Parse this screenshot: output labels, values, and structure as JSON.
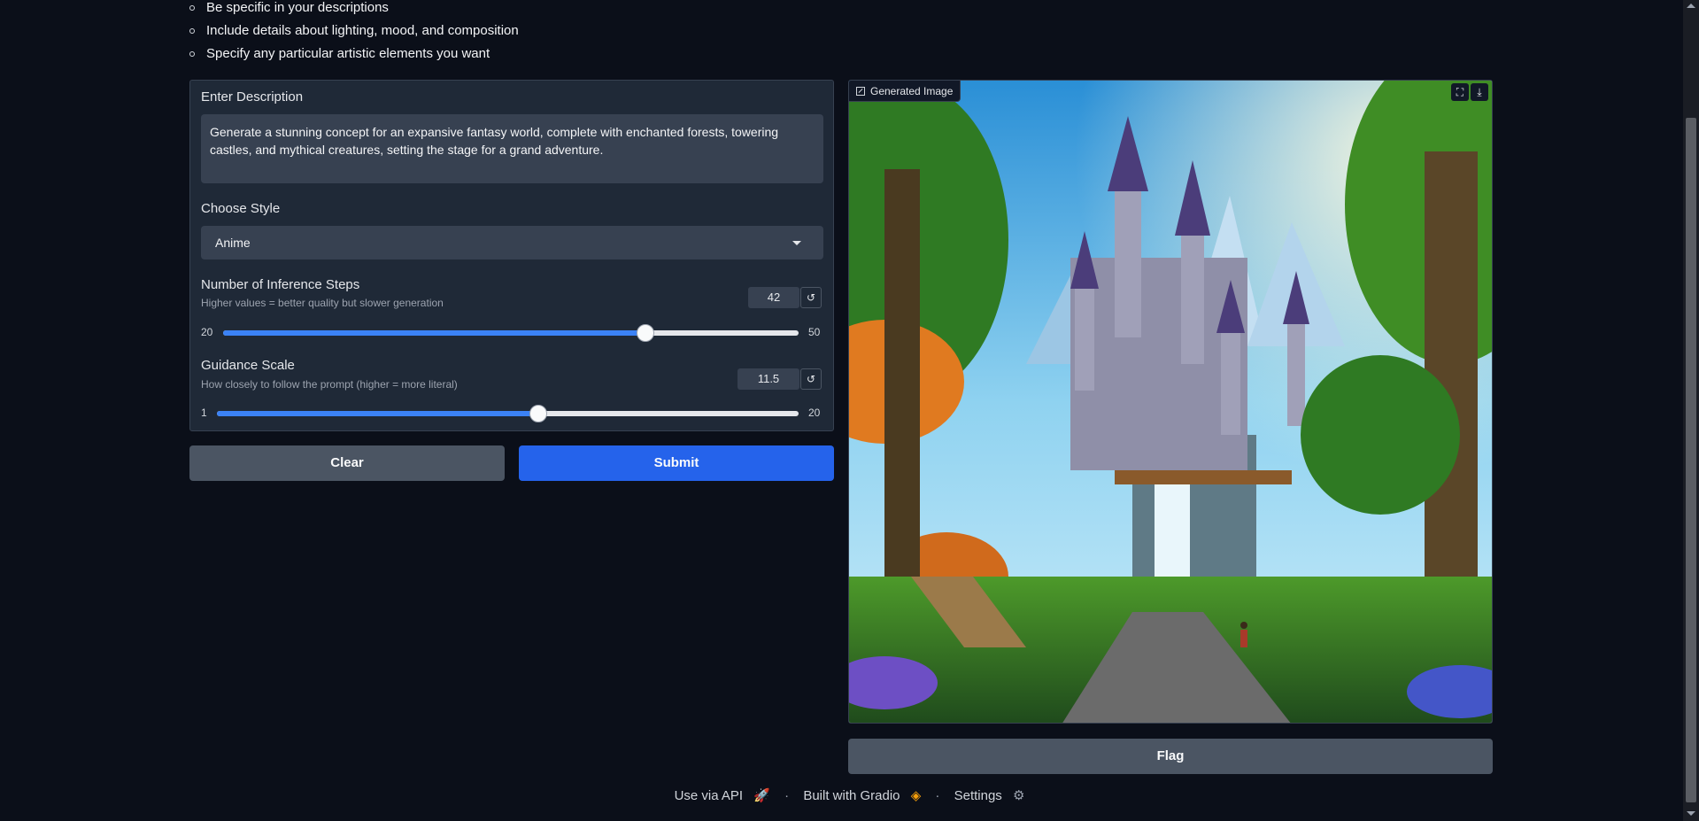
{
  "tips": [
    "Be specific in your descriptions",
    "Include details about lighting, mood, and composition",
    "Specify any particular artistic elements you want"
  ],
  "description": {
    "label": "Enter Description",
    "value": "Generate a stunning concept for an expansive fantasy world, complete with enchanted forests, towering castles, and mythical creatures, setting the stage for a grand adventure."
  },
  "style": {
    "label": "Choose Style",
    "value": "Anime"
  },
  "steps": {
    "label": "Number of Inference Steps",
    "info": "Higher values = better quality but slower generation",
    "value": "42",
    "min": "20",
    "max": "50",
    "reset_icon": "reset-icon"
  },
  "guidance": {
    "label": "Guidance Scale",
    "info": "How closely to follow the prompt (higher = more literal)",
    "value": "11.5",
    "min": "1",
    "max": "20",
    "reset_icon": "reset-icon"
  },
  "buttons": {
    "clear": "Clear",
    "submit": "Submit",
    "flag": "Flag"
  },
  "output": {
    "label": "Generated Image",
    "fullscreen_icon": "fullscreen-icon",
    "download_icon": "download-icon"
  },
  "footer": {
    "api": "Use via API",
    "gradio": "Built with Gradio",
    "settings": "Settings",
    "separator": "·"
  },
  "colors": {
    "background": "#0b0f19",
    "primary": "#2563eb",
    "slider_fill": "#3b82f6"
  }
}
